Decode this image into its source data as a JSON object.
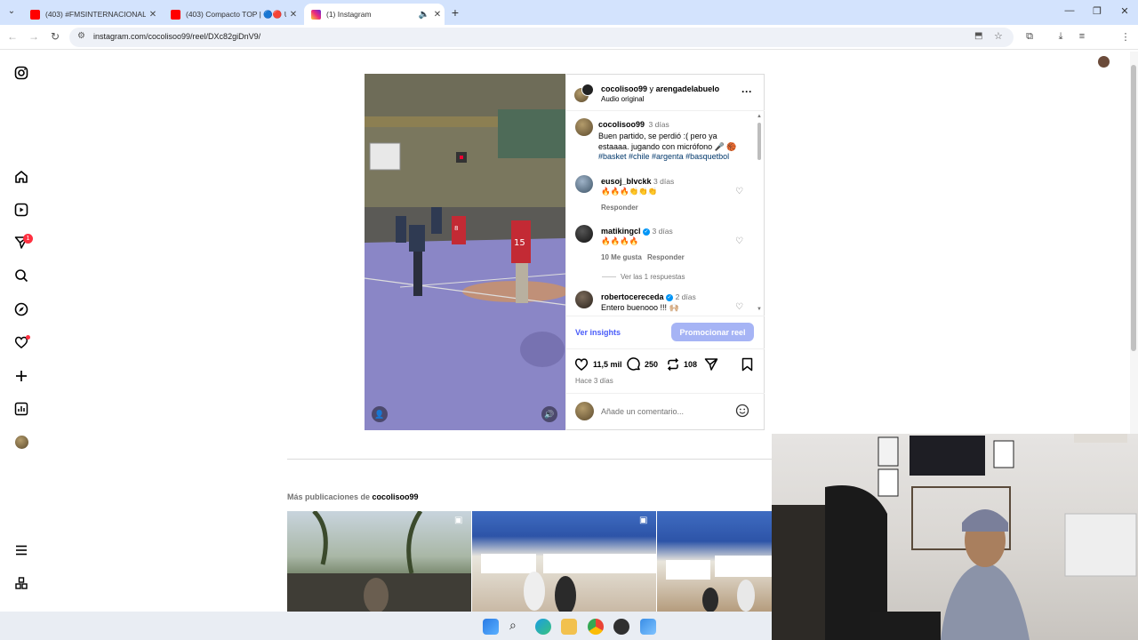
{
  "browser": {
    "tabs": [
      {
        "title": "(403) #FMSINTERNACIONAL 2024",
        "active": false
      },
      {
        "title": "(403) Compacto TOP | 🔵🔴 U",
        "active": false
      },
      {
        "title": "(1) Instagram",
        "active": true
      }
    ],
    "url": "instagram.com/cocolisoo99/reel/DXc82giDnV9/"
  },
  "post": {
    "header_user1": "cocolisoo99",
    "header_and": "y",
    "header_user2": "arengadelabuelo",
    "audio": "Audio original",
    "caption_user": "cocolisoo99",
    "caption_time": "3 días",
    "caption_text": "Buen partido, se perdió :( pero ya estaaaa. jugando con micrófono 🎤 🏀",
    "caption_tags": "#basket #chile #argenta #basquetbol",
    "comments": [
      {
        "user": "eusoj_blvckk",
        "time": "3 días",
        "text": "🔥🔥🔥👏👏👏",
        "meta": [
          "Responder"
        ]
      },
      {
        "user": "matikingcl",
        "time": "3 días",
        "text": "🔥🔥🔥🔥",
        "meta": [
          "10 Me gusta",
          "Responder"
        ],
        "replies": "Ver las 1 respuestas"
      },
      {
        "user": "robertocereceda",
        "time": "2 días",
        "text": "Entero buenooo !!! 🙌🏼"
      }
    ],
    "insights": "Ver insights",
    "promote": "Promocionar reel",
    "likes": "11,5 mil",
    "comments_count": "250",
    "reposts": "108",
    "posted": "Hace 3 días",
    "add_comment": "Añade un comentario..."
  },
  "more": {
    "prefix": "Más publicaciones de",
    "user": "cocolisoo99"
  },
  "colors": {
    "brand_blue": "#4a5df9",
    "promo": "#a6b4f5",
    "badge_red": "#ff3040"
  }
}
